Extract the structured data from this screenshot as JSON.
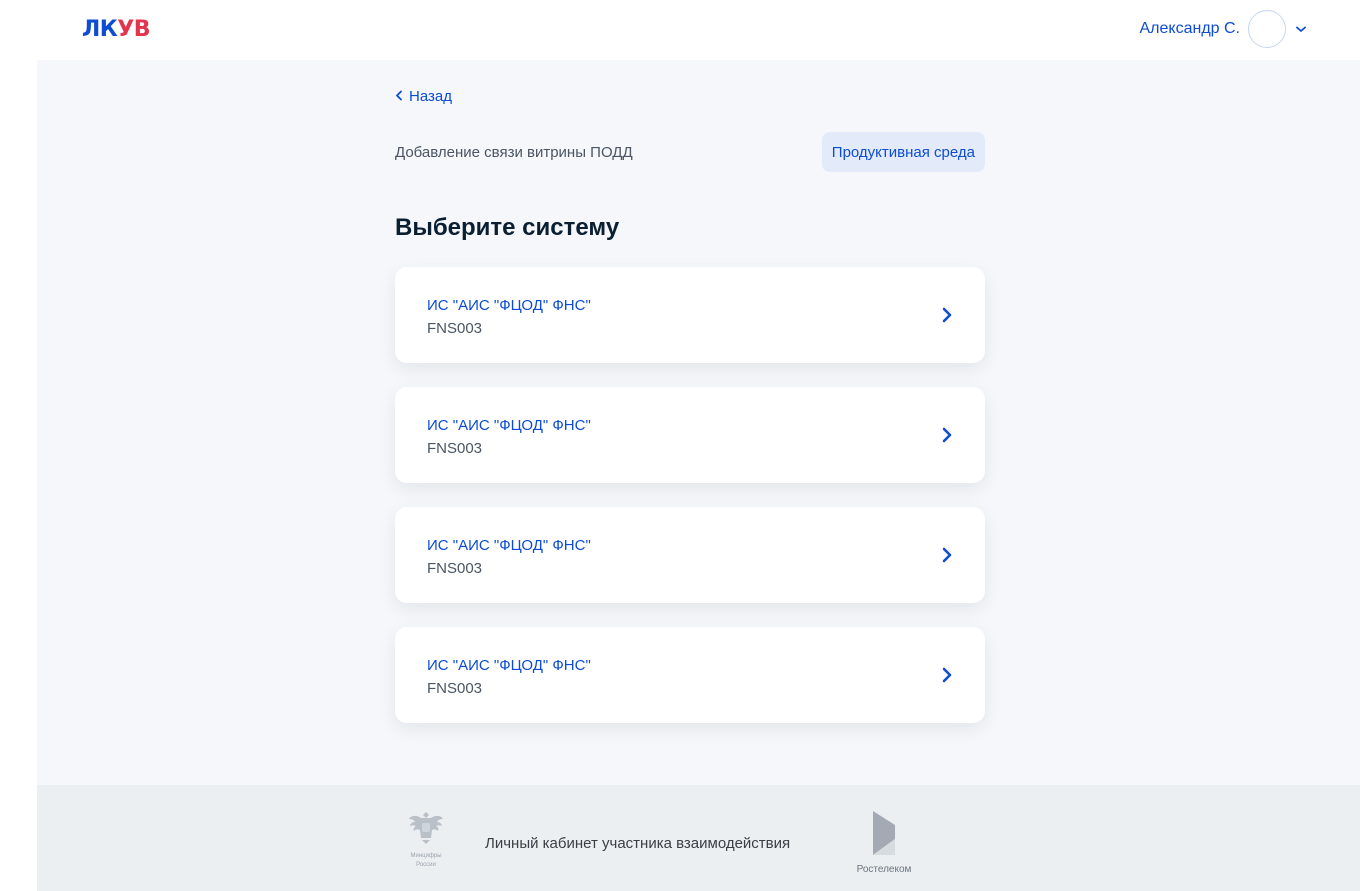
{
  "header": {
    "logo_part1": "ЛК",
    "logo_part2": "УВ",
    "user_name": "Александр С."
  },
  "nav": {
    "back_label": "Назад"
  },
  "page": {
    "subtitle": "Добавление связи витрины ПОДД",
    "environment_badge": "Продуктивная среда",
    "title": "Выберите систему"
  },
  "systems": [
    {
      "name": "ИС \"АИС \"ФЦОД\" ФНС\"",
      "code": "FNS003"
    },
    {
      "name": "ИС \"АИС \"ФЦОД\" ФНС\"",
      "code": "FNS003"
    },
    {
      "name": "ИС \"АИС \"ФЦОД\" ФНС\"",
      "code": "FNS003"
    },
    {
      "name": "ИС \"АИС \"ФЦОД\" ФНС\"",
      "code": "FNS003"
    }
  ],
  "footer": {
    "ministry_label_line1": "Минцифры",
    "ministry_label_line2": "России",
    "cabinet_text": "Личный кабинет участника взаимодействия",
    "partner_label": "Ростелеком"
  },
  "colors": {
    "accent": "#0d4cd3",
    "logo_red": "#e3344e",
    "page_bg": "#f5f7fa",
    "footer_bg": "#eceff2"
  }
}
